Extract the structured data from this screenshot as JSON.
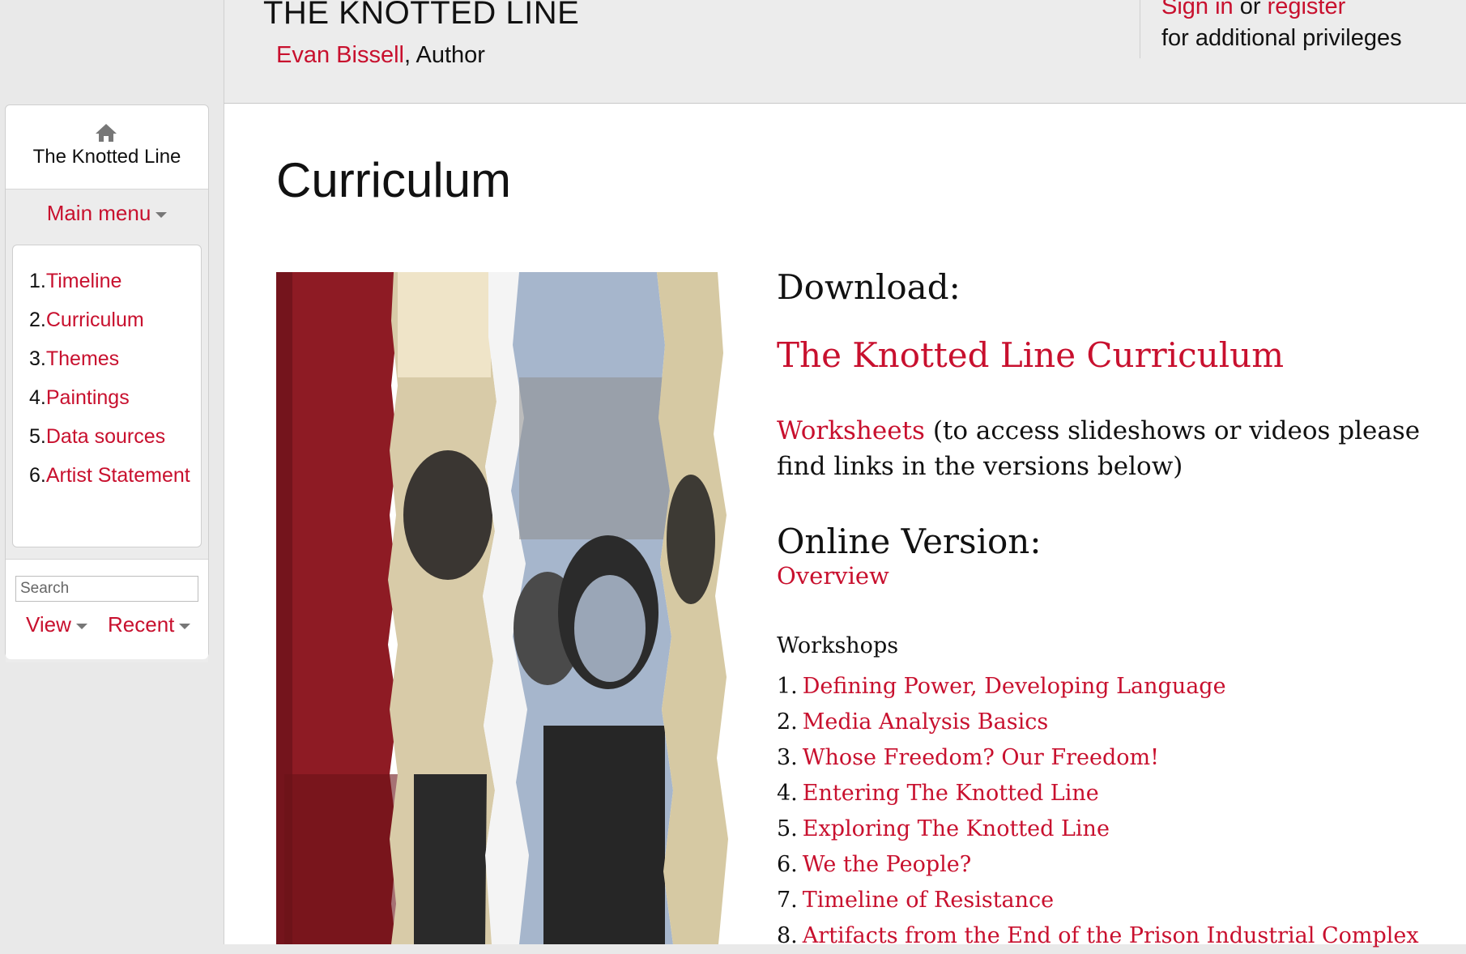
{
  "header": {
    "book_title": "THE KNOTTED LINE",
    "author_name": "Evan Bissell",
    "author_role": ", Author",
    "sign_in": "Sign in",
    "or": " or ",
    "register": "register",
    "privileges": "for additional privileges"
  },
  "sidebar": {
    "home_label": "The Knotted Line",
    "main_menu": "Main menu",
    "toc": [
      {
        "num": "1.",
        "label": "Timeline"
      },
      {
        "num": "2.",
        "label": "Curriculum"
      },
      {
        "num": "3.",
        "label": "Themes"
      },
      {
        "num": "4.",
        "label": "Paintings"
      },
      {
        "num": "5.",
        "label": "Data sources"
      },
      {
        "num": "6.",
        "label": "Artist Statement"
      }
    ],
    "search_placeholder": "Search",
    "view": "View",
    "recent": "Recent"
  },
  "main": {
    "title": "Curriculum",
    "download_heading": "Download:",
    "curriculum_link": "The Knotted Line Curriculum",
    "worksheets_link": "Worksheets",
    "worksheets_note": " (to access slideshows or videos please find links in the versions below)",
    "online_heading": "Online Version:",
    "overview_link": "Overview",
    "workshops_label": "Workshops",
    "workshops": [
      {
        "num": "1.",
        "label": "Defining Power, Developing Language"
      },
      {
        "num": "2.",
        "label": "Media Analysis Basics"
      },
      {
        "num": "3.",
        "label": "Whose Freedom? Our Freedom!"
      },
      {
        "num": "4.",
        "label": "Entering The Knotted Line"
      },
      {
        "num": "5.",
        "label": "Exploring The Knotted Line"
      },
      {
        "num": "6.",
        "label": "We the People?"
      },
      {
        "num": "7.",
        "label": "Timeline of Resistance"
      },
      {
        "num": "8.",
        "label": "Artifacts from the End of the Prison Industrial Complex"
      }
    ]
  },
  "colors": {
    "accent": "#c8102e",
    "page_bg": "#e9e9e9",
    "content_bg": "#ffffff"
  }
}
